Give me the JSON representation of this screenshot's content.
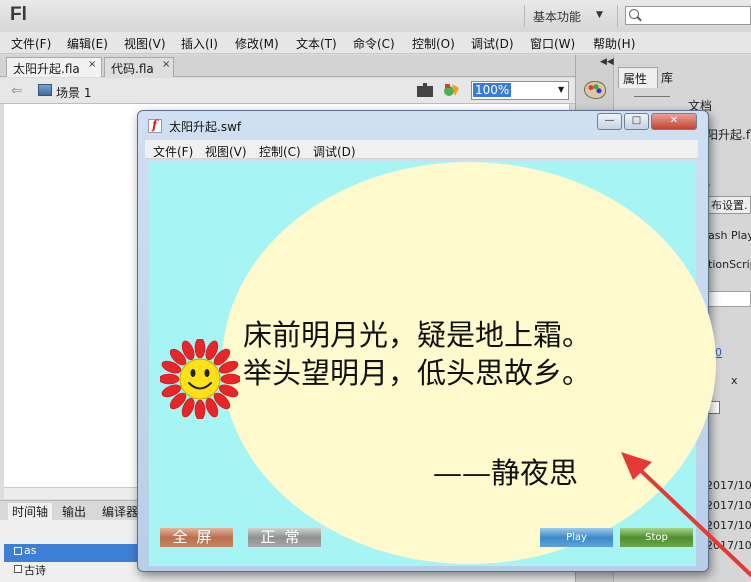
{
  "app": {
    "logo": "Fl",
    "workspace": "基本功能",
    "search_placeholder": ""
  },
  "menu": [
    "文件(F)",
    "编辑(E)",
    "视图(V)",
    "插入(I)",
    "修改(M)",
    "文本(T)",
    "命令(C)",
    "控制(O)",
    "调试(D)",
    "窗口(W)",
    "帮助(H)"
  ],
  "doc_tabs": [
    {
      "label": "太阳升起.fla",
      "close": "×"
    },
    {
      "label": "代码.fla",
      "close": "×"
    }
  ],
  "editbar": {
    "scene": "场景 1",
    "zoom": "100%"
  },
  "timeline": {
    "tabs": [
      "时间轴",
      "输出",
      "编译器"
    ],
    "layers": [
      "as",
      "古诗"
    ]
  },
  "right_panel": {
    "tabs": [
      "属性",
      "库"
    ],
    "doc_label": "文档",
    "doc_name": "阳升起.fl",
    "fragments": [
      "\\",
      "布设置.",
      "ash Playe",
      "tionScrip",
      "00",
      "x",
      "2017/10/",
      "2017/10/",
      "2017/10/",
      "2017/10/"
    ]
  },
  "swf_window": {
    "title": "太阳升起.swf",
    "menu": [
      "文件(F)",
      "视图(V)",
      "控制(C)",
      "调试(D)"
    ],
    "win_buttons": {
      "minimize": "—",
      "maximize": "□",
      "close": "✕"
    }
  },
  "poem": {
    "line1": "床前明月光，疑是地上霜。",
    "line2": "举头望明月，低头思故乡。",
    "title": "——静夜思"
  },
  "swf_buttons": {
    "fullscreen": "全屏",
    "normal": "正常",
    "play": "Play",
    "stop": "Stop"
  },
  "colors": {
    "stage_bg": "#a6f4f4",
    "moon": "#fffacd",
    "arrow": "#e53935",
    "zoom_highlight": "#3a7bd5"
  }
}
